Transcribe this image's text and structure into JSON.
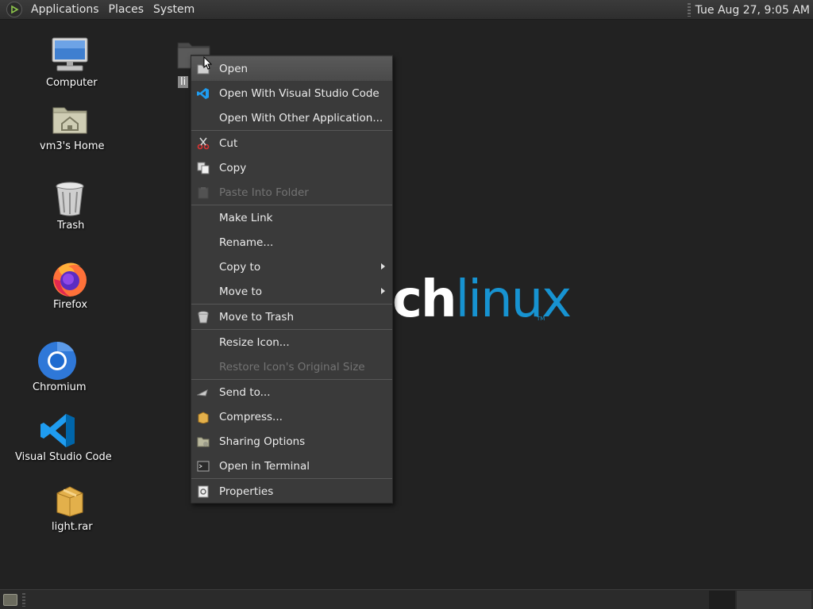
{
  "top_panel": {
    "menus": [
      "Applications",
      "Places",
      "System"
    ],
    "clock": "Tue Aug 27,  9:05 AM"
  },
  "desktop_icons": [
    {
      "label": "Computer",
      "icon": "computer-icon"
    },
    {
      "label": "vm3's Home",
      "icon": "home-folder-icon"
    },
    {
      "label": "Trash",
      "icon": "trash-icon"
    },
    {
      "label": "Firefox",
      "icon": "firefox-icon"
    },
    {
      "label": "Chromium",
      "icon": "chromium-icon"
    },
    {
      "label": "Visual Studio Code",
      "icon": "vscode-icon"
    },
    {
      "label": "light.rar",
      "icon": "archive-icon"
    }
  ],
  "selected_folder": {
    "label_partial": "li",
    "icon": "folder-icon"
  },
  "wallpaper": {
    "logo_part1": "ch",
    "logo_part2": "linux",
    "trademark": "TM"
  },
  "context_menu": {
    "groups": [
      [
        {
          "label": "Open",
          "icon": "open-icon",
          "highlighted": true
        },
        {
          "label": "Open With Visual Studio Code",
          "icon": "vscode-icon"
        },
        {
          "label": "Open With Other Application...",
          "icon": ""
        }
      ],
      [
        {
          "label": "Cut",
          "icon": "scissors-icon"
        },
        {
          "label": "Copy",
          "icon": "copy-icon"
        },
        {
          "label": "Paste Into Folder",
          "icon": "paste-icon",
          "disabled": true
        }
      ],
      [
        {
          "label": "Make Link",
          "icon": ""
        },
        {
          "label": "Rename...",
          "icon": ""
        },
        {
          "label": "Copy to",
          "icon": "",
          "submenu": true
        },
        {
          "label": "Move to",
          "icon": "",
          "submenu": true
        }
      ],
      [
        {
          "label": "Move to Trash",
          "icon": "trash-icon"
        }
      ],
      [
        {
          "label": "Resize Icon...",
          "icon": ""
        },
        {
          "label": "Restore Icon's Original Size",
          "icon": "",
          "disabled": true
        }
      ],
      [
        {
          "label": "Send to...",
          "icon": "send-icon"
        },
        {
          "label": "Compress...",
          "icon": "compress-icon"
        },
        {
          "label": "Sharing Options",
          "icon": "share-icon"
        },
        {
          "label": "Open in Terminal",
          "icon": "terminal-icon"
        }
      ],
      [
        {
          "label": "Properties",
          "icon": "properties-icon"
        }
      ]
    ]
  },
  "colors": {
    "accent": "#1793d1",
    "desktop_bg": "#222222",
    "menu_bg": "#3a3a3a",
    "disabled_text": "#737373"
  }
}
